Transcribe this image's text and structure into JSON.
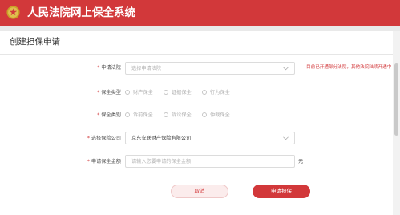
{
  "app": {
    "title": "人民法院网上保全系统"
  },
  "page": {
    "title": "创建担保申请"
  },
  "form": {
    "court": {
      "label": "申请法院",
      "placeholder": "选择申请法院",
      "hint": "目前已开通部分法院，其他法院陆续开通中"
    },
    "preservation_type": {
      "label": "保全类型",
      "options": [
        "财产保全",
        "证据保全",
        "行为保全"
      ]
    },
    "preservation_category": {
      "label": "保全类别",
      "options": [
        "诉前保全",
        "诉讼保全",
        "仲裁保全"
      ]
    },
    "insurer": {
      "label": "选择保险公司",
      "value": "京东安联财产保险有限公司"
    },
    "amount": {
      "label": "申请保全金额",
      "placeholder": "请输入您要申请的保全金额",
      "unit": "元"
    }
  },
  "actions": {
    "cancel": "取消",
    "submit": "申请担保"
  },
  "colors": {
    "brand": "#d2383a"
  }
}
